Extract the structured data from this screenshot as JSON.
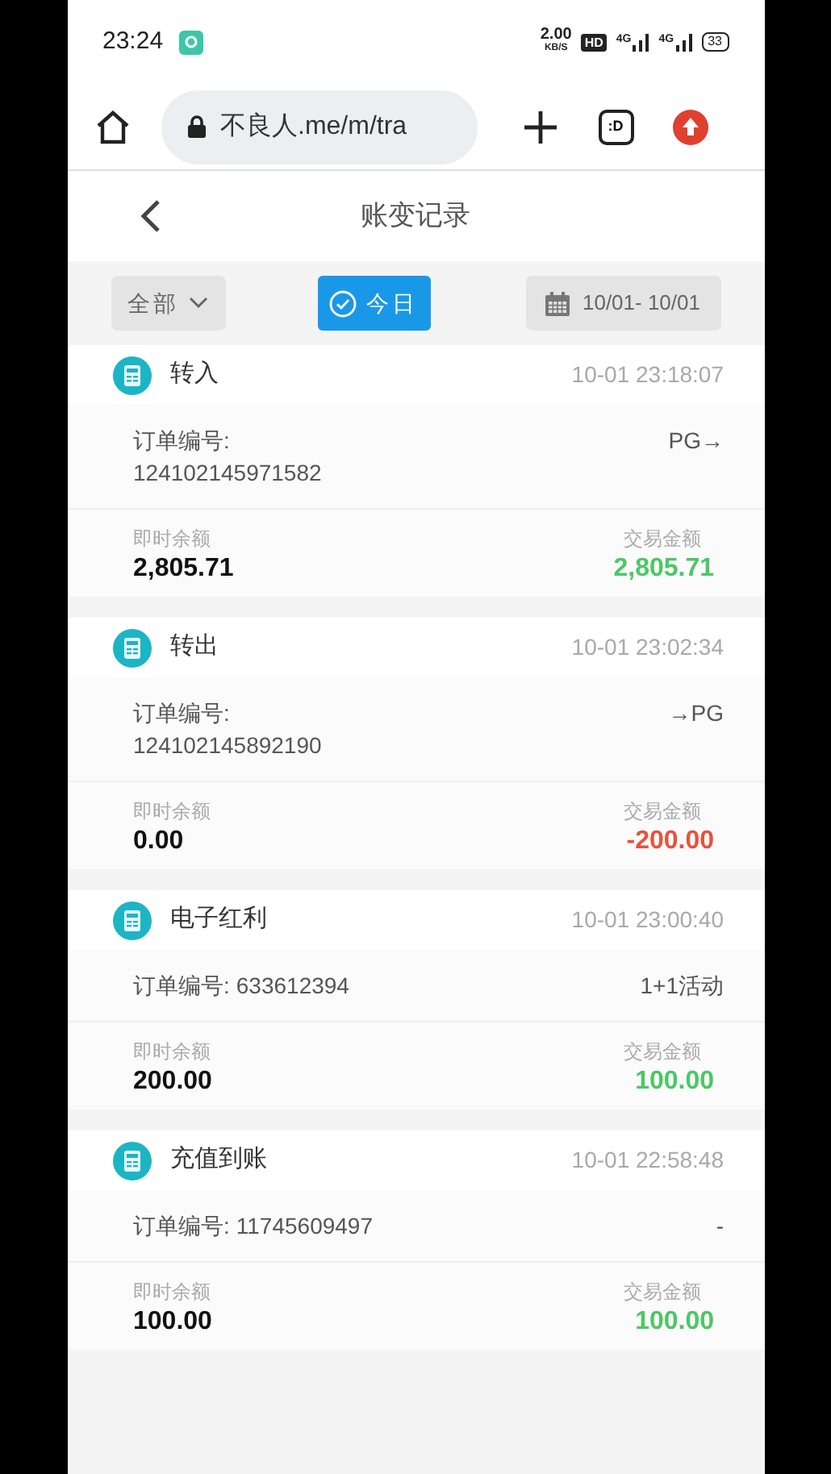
{
  "status_bar": {
    "time": "23:24",
    "speed": "2.00",
    "speed_unit": "KB/S",
    "hd": "HD",
    "net1": "4G",
    "net2": "4G",
    "battery": "33"
  },
  "browser": {
    "url": "不良人.me/m/tra",
    "tabs_label": ":D"
  },
  "header": {
    "title": "账变记录"
  },
  "filters": {
    "type_label": "全部",
    "today": {
      "label": "今日",
      "selected": true
    },
    "date_range": "10/01- 10/01"
  },
  "records": [
    {
      "title": "转入",
      "time": "10-01 23:18:07",
      "order_label": "订单编号:",
      "order_number": "124102145971582",
      "stacked": true,
      "note": "PG→",
      "balance_label": "即时余额",
      "balance": "2,805.71",
      "amount_label": "交易金额",
      "amount": "2,805.71",
      "kind": "credit"
    },
    {
      "title": "转出",
      "time": "10-01 23:02:34",
      "order_label": "订单编号:",
      "order_number": "124102145892190",
      "stacked": true,
      "note": "→PG",
      "balance_label": "即时余额",
      "balance": "0.00",
      "amount_label": "交易金额",
      "amount": "-200.00",
      "kind": "debit"
    },
    {
      "title": "电子红利",
      "time": "10-01 23:00:40",
      "order_label": "订单编号:",
      "order_number": "633612394",
      "stacked": false,
      "note": "1+1活动",
      "balance_label": "即时余额",
      "balance": "200.00",
      "amount_label": "交易金额",
      "amount": "100.00",
      "kind": "credit"
    },
    {
      "title": "充值到账",
      "time": "10-01 22:58:48",
      "order_label": "订单编号:",
      "order_number": "11745609497",
      "stacked": false,
      "note": "-",
      "balance_label": "即时余额",
      "balance": "100.00",
      "amount_label": "交易金额",
      "amount": "100.00",
      "kind": "credit"
    }
  ]
}
